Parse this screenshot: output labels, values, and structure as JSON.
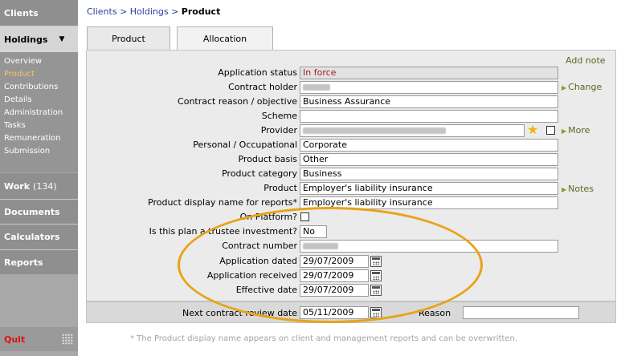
{
  "sidebar": {
    "clients": "Clients",
    "holdings": "Holdings",
    "holdings_arrow": "▼",
    "sub_items": [
      "Overview",
      "Product",
      "Contributions",
      "Details",
      "Administration",
      "Tasks",
      "Remuneration",
      "Submission"
    ],
    "work_label": "Work",
    "work_count": "(134)",
    "documents": "Documents",
    "calculators": "Calculators",
    "reports": "Reports",
    "quit": "Quit"
  },
  "breadcrumb": {
    "clients": "Clients",
    "sep1": " > ",
    "holdings": "Holdings",
    "sep2": " > ",
    "current": "Product"
  },
  "tabs": [
    {
      "label": "Product"
    },
    {
      "label": "Allocation"
    }
  ],
  "form": {
    "add_note": "Add note",
    "application_status": {
      "label": "Application status",
      "value": "In force"
    },
    "contract_holder": {
      "label": "Contract holder"
    },
    "contract_reason": {
      "label": "Contract reason / objective",
      "value": "Business Assurance"
    },
    "scheme": {
      "label": "Scheme",
      "value": ""
    },
    "provider": {
      "label": "Provider"
    },
    "personal_occupational": {
      "label": "Personal / Occupational",
      "value": "Corporate"
    },
    "product_basis": {
      "label": "Product basis",
      "value": "Other"
    },
    "product_category": {
      "label": "Product category",
      "value": "Business"
    },
    "product": {
      "label": "Product",
      "value": "Employer's liability insurance"
    },
    "display_name": {
      "label": "Product display name for reports*",
      "value": "Employer's liability insurance"
    },
    "on_platform": {
      "label": "On Platform?"
    },
    "trustee": {
      "label": "Is this plan a trustee investment?",
      "value": "No"
    },
    "contract_number": {
      "label": "Contract number"
    },
    "application_dated": {
      "label": "Application dated",
      "value": "29/07/2009"
    },
    "application_received": {
      "label": "Application received",
      "value": "29/07/2009"
    },
    "effective_date": {
      "label": "Effective date",
      "value": "29/07/2009"
    },
    "next_review": {
      "label": "Next contract review date",
      "value": "05/11/2009"
    },
    "reason": {
      "label": "Reason",
      "value": ""
    },
    "change_link": "Change",
    "more_link": "More",
    "notes_link": "Notes"
  },
  "footnote": "* The Product display name appears on client and management reports and can be overwritten.",
  "colors": {
    "highlight_ellipse": "#e8a317",
    "active_nav": "#f7c36b",
    "status_text": "#9b1c1c",
    "quit": "#dd1111"
  }
}
